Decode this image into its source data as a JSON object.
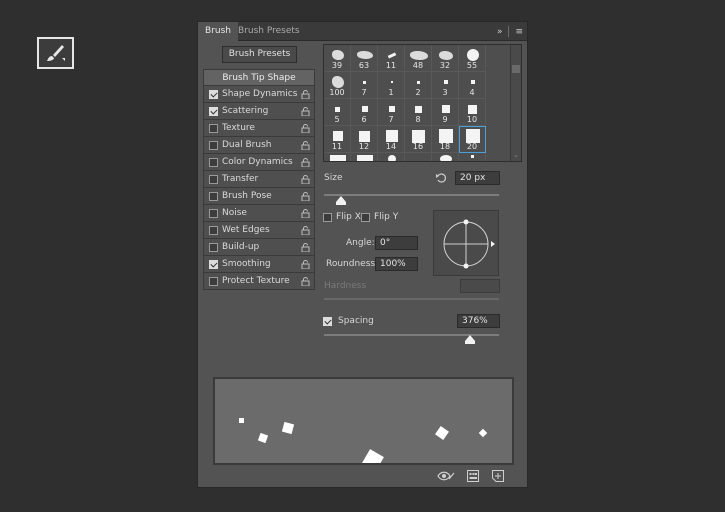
{
  "tabs": [
    {
      "label": "Brush",
      "active": true
    },
    {
      "label": "Brush Presets",
      "active": false
    }
  ],
  "tabbar": {
    "collapse": "»",
    "menu": "≡"
  },
  "presets_button": "Brush Presets",
  "options": {
    "header": "Brush Tip Shape",
    "items": [
      {
        "label": "Shape Dynamics",
        "checked": true
      },
      {
        "label": "Scattering",
        "checked": true
      },
      {
        "label": "Texture",
        "checked": false
      },
      {
        "label": "Dual Brush",
        "checked": false
      },
      {
        "label": "Color Dynamics",
        "checked": false
      },
      {
        "label": "Transfer",
        "checked": false
      },
      {
        "label": "Brush Pose",
        "checked": false
      },
      {
        "label": "Noise",
        "checked": false
      },
      {
        "label": "Wet Edges",
        "checked": false
      },
      {
        "label": "Build-up",
        "checked": false
      },
      {
        "label": "Smoothing",
        "checked": true
      },
      {
        "label": "Protect Texture",
        "checked": false
      }
    ]
  },
  "brushes": [
    "39",
    "63",
    "11",
    "48",
    "32",
    "55",
    "100",
    "7",
    "1",
    "2",
    "3",
    "4",
    "5",
    "6",
    "7",
    "8",
    "9",
    "10",
    "11",
    "12",
    "14",
    "16",
    "18",
    "20",
    "",
    "",
    "",
    "",
    "",
    ""
  ],
  "selected_brush": 23,
  "size": {
    "label": "Size",
    "value": "20 px"
  },
  "flip_x": {
    "label": "Flip X",
    "checked": false
  },
  "flip_y": {
    "label": "Flip Y",
    "checked": false
  },
  "angle": {
    "label": "Angle:",
    "value": "0°"
  },
  "roundness": {
    "label": "Roundness:",
    "value": "100%"
  },
  "hardness": {
    "label": "Hardness",
    "value": ""
  },
  "spacing": {
    "label": "Spacing",
    "checked": true,
    "value": "376%"
  },
  "colors": {
    "panel": "#535353",
    "background": "#2f2f2f",
    "selection": "#4aa0d8",
    "preview": "#6b6b6b"
  }
}
